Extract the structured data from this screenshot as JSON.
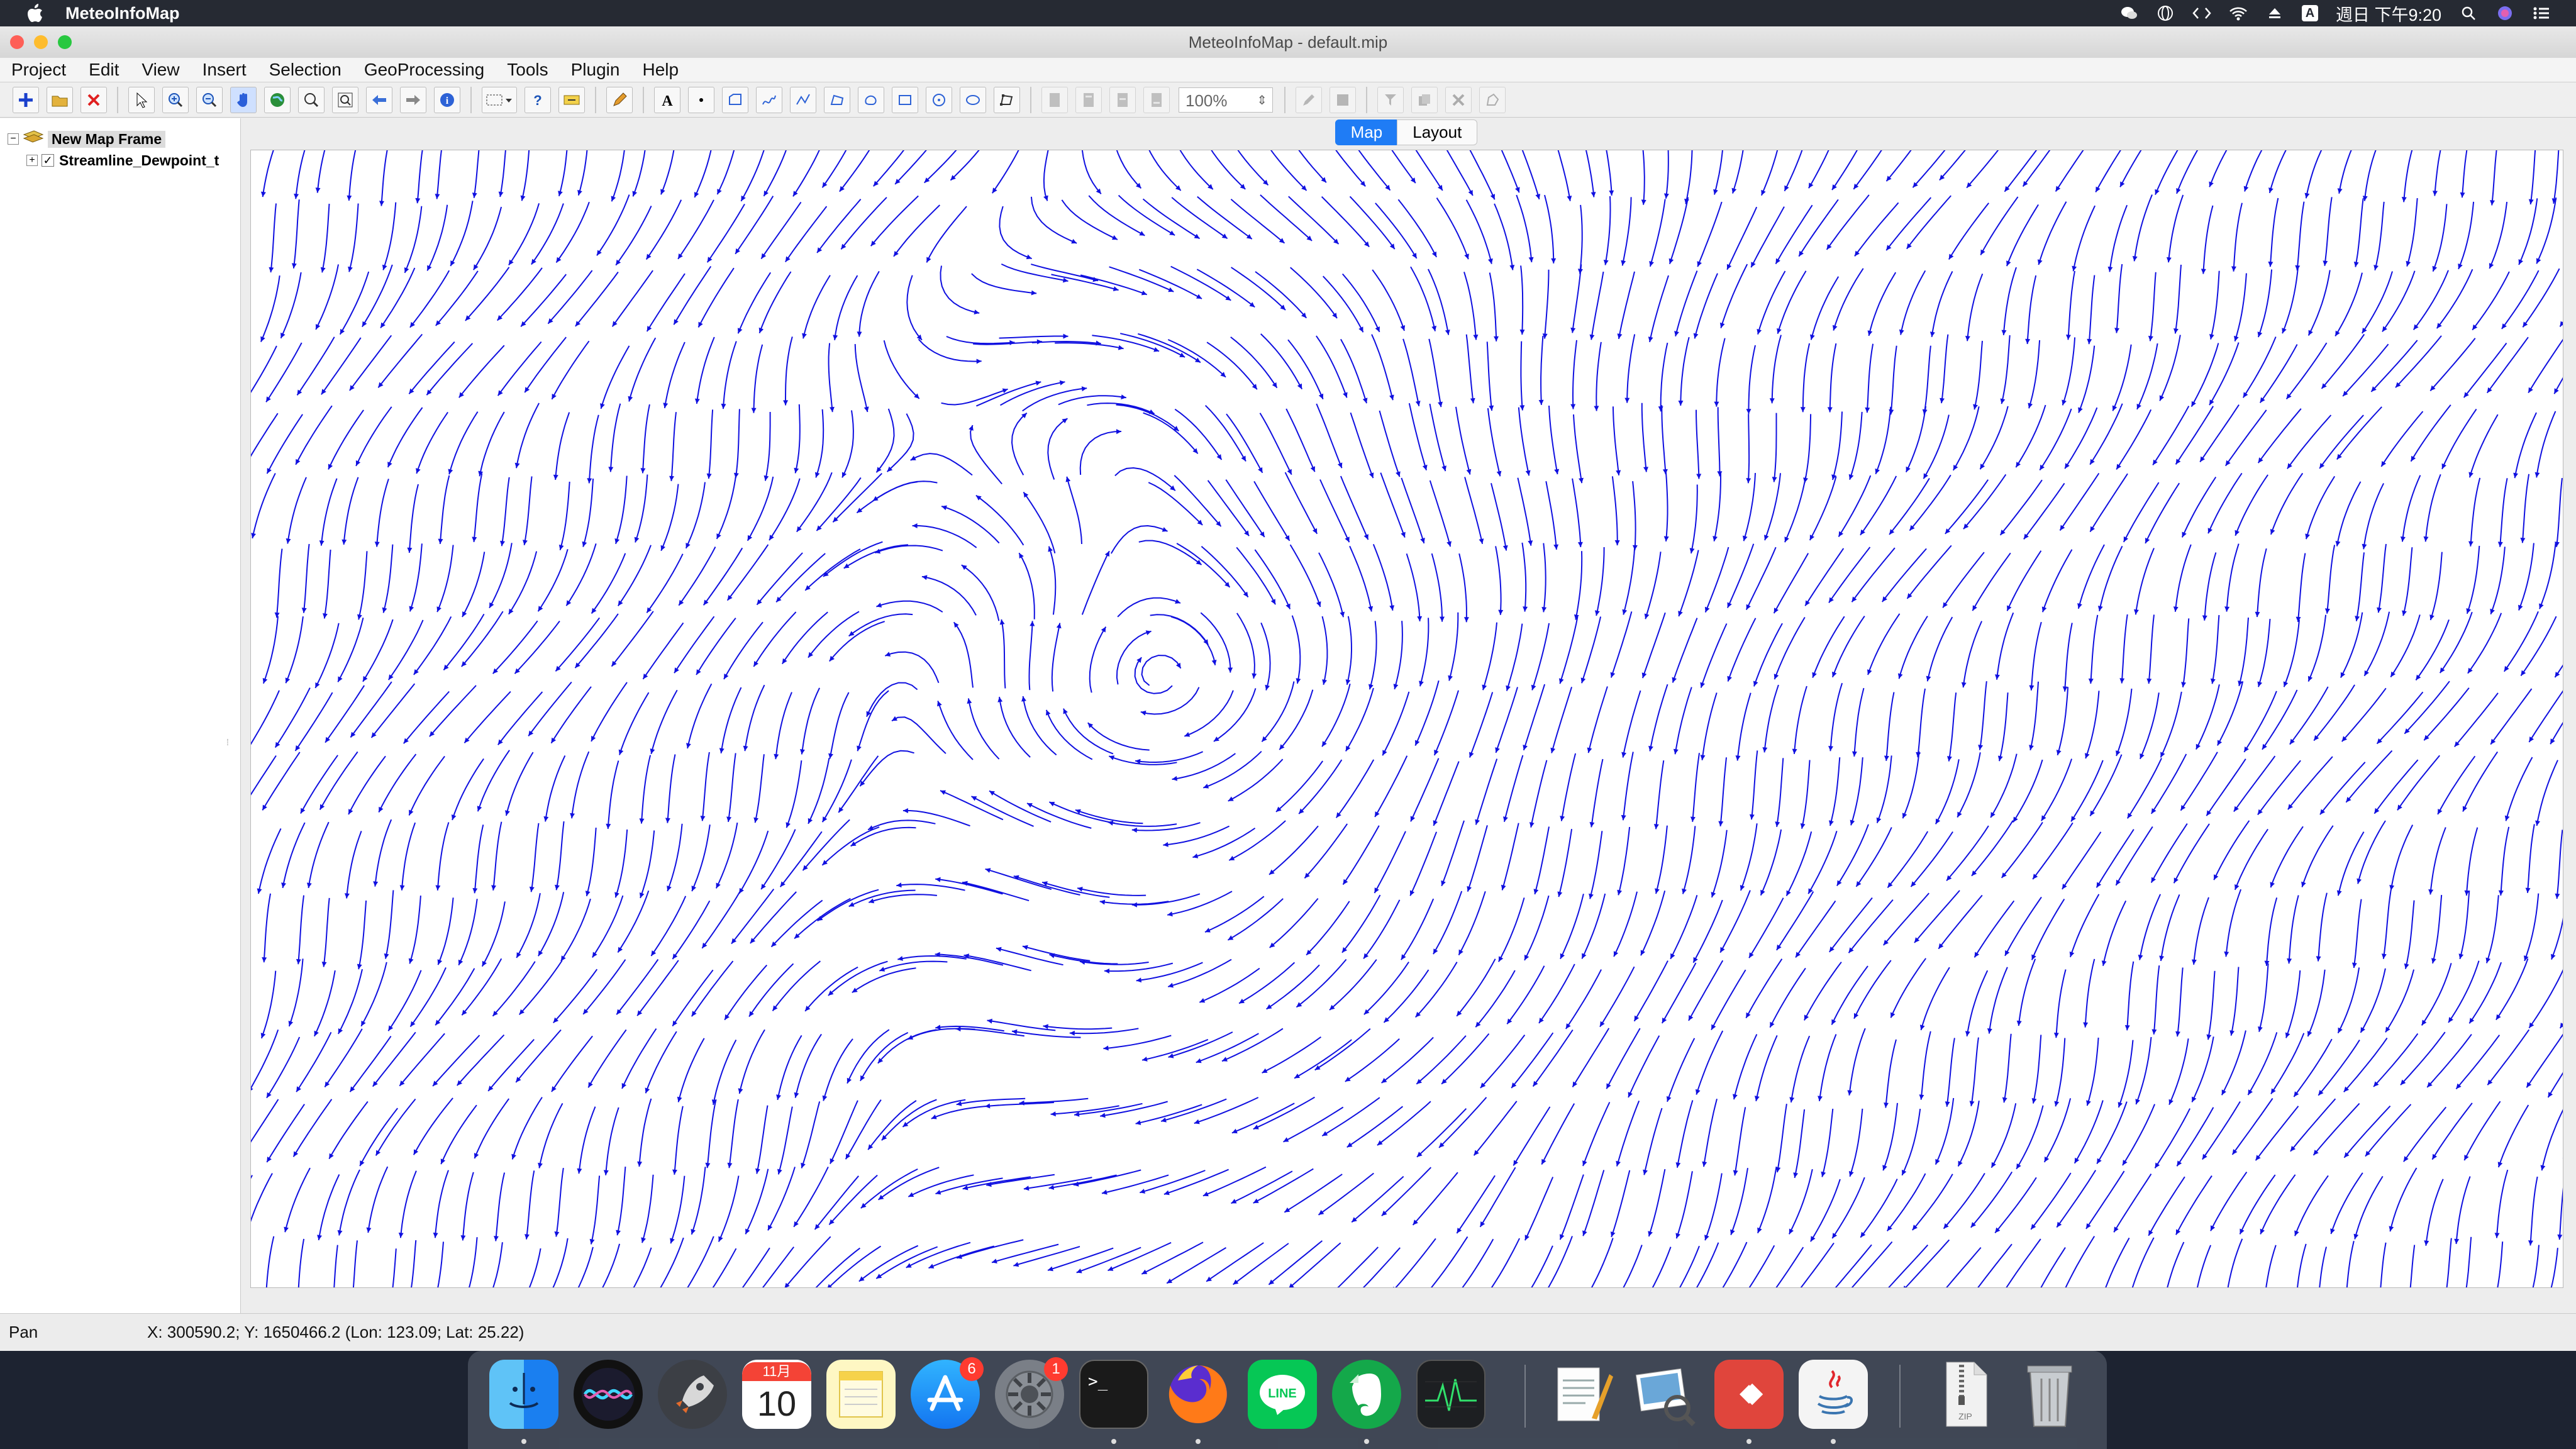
{
  "menubar": {
    "app_name": "MeteoInfoMap",
    "clock": "週日 下午9:20",
    "input_source": "A"
  },
  "window": {
    "title": "MeteoInfoMap - default.mip"
  },
  "menu": [
    "Project",
    "Edit",
    "View",
    "Insert",
    "Selection",
    "GeoProcessing",
    "Tools",
    "Plugin",
    "Help"
  ],
  "toolbar": {
    "zoom_value": "100%"
  },
  "legend_tree": {
    "frame_label": "New Map Frame",
    "layer_label": "Streamline_Dewpoint_t"
  },
  "tabs": {
    "map": "Map",
    "layout": "Layout"
  },
  "streamline": {
    "color": "#1010e0",
    "background": "#ffffff"
  },
  "status": {
    "mode": "Pan",
    "coordinates": "X: 300590.2; Y: 1650466.2 (Lon: 123.09; Lat: 25.22)"
  },
  "dock": {
    "calendar_month": "11月",
    "calendar_day": "10",
    "appstore_badge": "6",
    "settings_badge": "1",
    "terminal_prompt": ">_",
    "zip_label": "ZIP"
  }
}
